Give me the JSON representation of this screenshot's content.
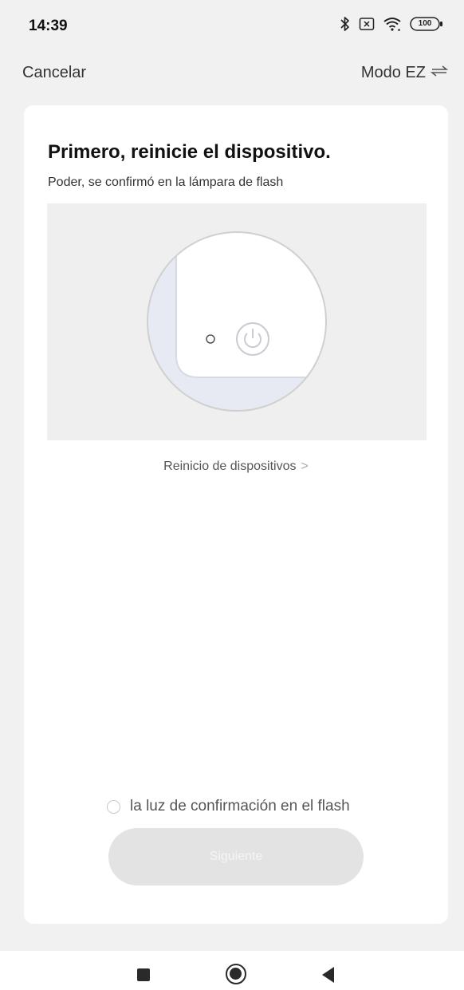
{
  "status_bar": {
    "time": "14:39",
    "battery": "100",
    "icons": [
      "bluetooth-icon",
      "sim-x-icon",
      "wifi-icon",
      "battery-icon"
    ]
  },
  "header": {
    "cancel_label": "Cancelar",
    "mode_label": "Modo EZ",
    "mode_icon": "swap-icon"
  },
  "card": {
    "title": "Primero, reinicie el dispositivo.",
    "subtitle": "Poder, se confirmó en la lámpara de flash",
    "reset_link": "Reinicio de dispositivos",
    "reset_link_chevron": ">",
    "confirm_label": "la luz de confirmación en el flash",
    "confirm_checked": false,
    "next_label": "Siguiente"
  },
  "nav": {
    "items": [
      "recents-button",
      "home-button",
      "back-button"
    ]
  },
  "colors": {
    "background": "#f1f1f1",
    "card": "#ffffff",
    "button_disabled": "#e3e3e3",
    "illustration_bg": "#efefef"
  }
}
